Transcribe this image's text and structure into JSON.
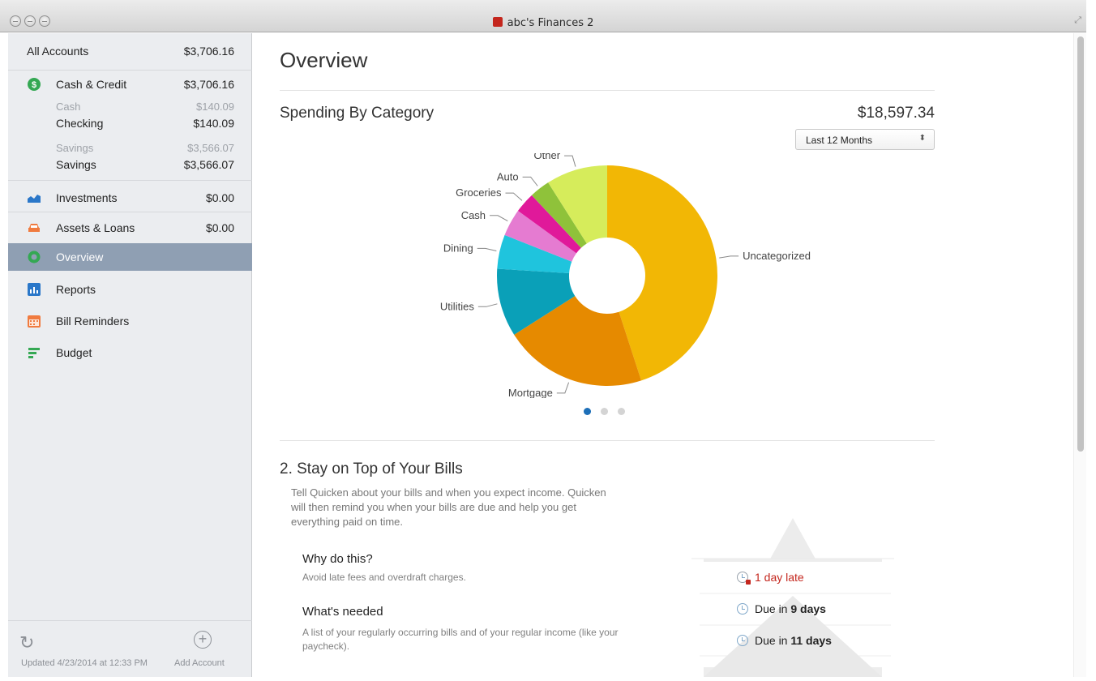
{
  "window": {
    "title": "abc's Finances 2"
  },
  "sidebar": {
    "all_accounts": {
      "label": "All Accounts",
      "amount": "$3,706.16"
    },
    "cash_credit": {
      "label": "Cash & Credit",
      "amount": "$3,706.16",
      "icon": "dollar-circle-icon",
      "color": "#34a853"
    },
    "cash_group": {
      "label": "Cash",
      "amount": "$140.09"
    },
    "checking": {
      "label": "Checking",
      "amount": "$140.09"
    },
    "savings_group": {
      "label": "Savings",
      "amount": "$3,566.07"
    },
    "savings": {
      "label": "Savings",
      "amount": "$3,566.07"
    },
    "investments": {
      "label": "Investments",
      "amount": "$0.00",
      "icon": "investment-chart-icon"
    },
    "assets_loans": {
      "label": "Assets & Loans",
      "amount": "$0.00",
      "icon": "car-icon"
    },
    "nav": [
      {
        "label": "Overview",
        "icon": "overview-icon",
        "selected": true
      },
      {
        "label": "Reports",
        "icon": "reports-icon"
      },
      {
        "label": "Bill Reminders",
        "icon": "calendar-icon"
      },
      {
        "label": "Budget",
        "icon": "budget-icon"
      }
    ],
    "footer": {
      "updated": "Updated 4/23/2014 at 12:33 PM",
      "add_account": "Add Account"
    }
  },
  "main": {
    "title": "Overview",
    "spending": {
      "title": "Spending By Category",
      "total": "$18,597.34",
      "period": "Last 12 Months"
    },
    "bills": {
      "title": "2. Stay on Top of Your Bills",
      "description": "Tell Quicken about your bills and when you expect income. Quicken will then remind you when your bills are due and help you get everything paid on time.",
      "why_title": "Why do this?",
      "why_text": "Avoid late fees and overdraft charges.",
      "needed_title": "What's needed",
      "needed_text": "A list of your regularly occurring bills and of your regular income (like your paycheck).",
      "reminders": [
        {
          "text": "1 day late",
          "color": "#c4261d"
        },
        {
          "prefix": "Due in ",
          "strong": "9 days"
        },
        {
          "prefix": "Due in ",
          "strong": "11 days"
        }
      ]
    }
  },
  "chart_data": {
    "type": "pie",
    "categories": [
      "Uncategorized",
      "Mortgage",
      "Utilities",
      "Dining",
      "Cash",
      "Groceries",
      "Auto",
      "Other"
    ],
    "values": [
      45,
      21,
      10,
      5,
      4,
      3,
      3,
      9
    ],
    "colors": [
      "#f2b705",
      "#e68a00",
      "#0aa0b8",
      "#1fc4dd",
      "#e57bd1",
      "#e0199a",
      "#8fc23a",
      "#d6ec5b"
    ],
    "title": "Spending By Category"
  },
  "carousel": {
    "active": 0,
    "count": 3
  }
}
